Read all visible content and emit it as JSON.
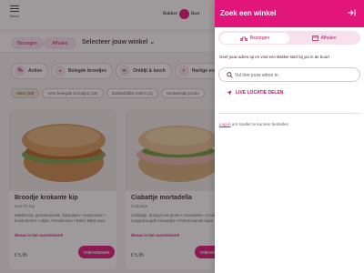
{
  "header": {
    "menu_label": "Menu",
    "logo_text_left": "Bakker",
    "logo_text_right": "Bart"
  },
  "mode_bar": {
    "bezorgen_label": "Bezorgen",
    "afhalen_label": "Afhalen",
    "store_select_label": "Selecteer jouw winkel"
  },
  "categories": [
    {
      "label": "Acties",
      "icon": "tag-icon"
    },
    {
      "label": "Belegde broodjes",
      "icon": "sandwich-icon"
    },
    {
      "label": "Ontbijt & lunch",
      "icon": "cup-icon"
    },
    {
      "label": "Hartige snacks",
      "icon": "snack-icon"
    }
  ],
  "chips": [
    {
      "label": "Alles (26)",
      "active": true
    },
    {
      "label": "Vers belegde broodjes (16)",
      "active": false
    },
    {
      "label": "Dubbeldikke tosti's (4)",
      "active": false
    },
    {
      "label": "Verdwende produ",
      "active": false
    }
  ],
  "products": [
    {
      "title": "Broodje krokante kip",
      "subtitle": "Bart's® kip",
      "desc": "Maisbrood, gemarineerde, kipstukjes • mayonaise • komkommer • uitjes • kruidenmix • Bart's BBQ saus",
      "link": "Nieuw in het assortiment!",
      "price": "€ 5,95",
      "button": "TOEVOEGEN"
    },
    {
      "title": "Ciabattje mortadella",
      "subtitle": "Ciabattje",
      "desc": "Ciabattje, belegd met pesto • mortadella • rucola • zongedroogde tomaatjes • Parmezaanse kaas",
      "link": "Nieuw in het assortiment!",
      "price": "€ 5,95",
      "button": "TOEVOEGEN"
    }
  ],
  "drawer": {
    "title": "Zoek een winkel",
    "toggle_bezorgen": "Bezorgen",
    "toggle_afhalen": "Afhalen",
    "info": "Geef jouw adres op en vind een Bakker Bart bij jou in de buurt",
    "search_placeholder": "Vul hier jouw adres in",
    "live_location": "LIVE LOCATIE DELEN",
    "login_link": "Log in",
    "login_rest": " om sneller te kunnen bestellen"
  },
  "colors": {
    "brand": "#e2157a",
    "brand_light": "#f7e1ec"
  }
}
